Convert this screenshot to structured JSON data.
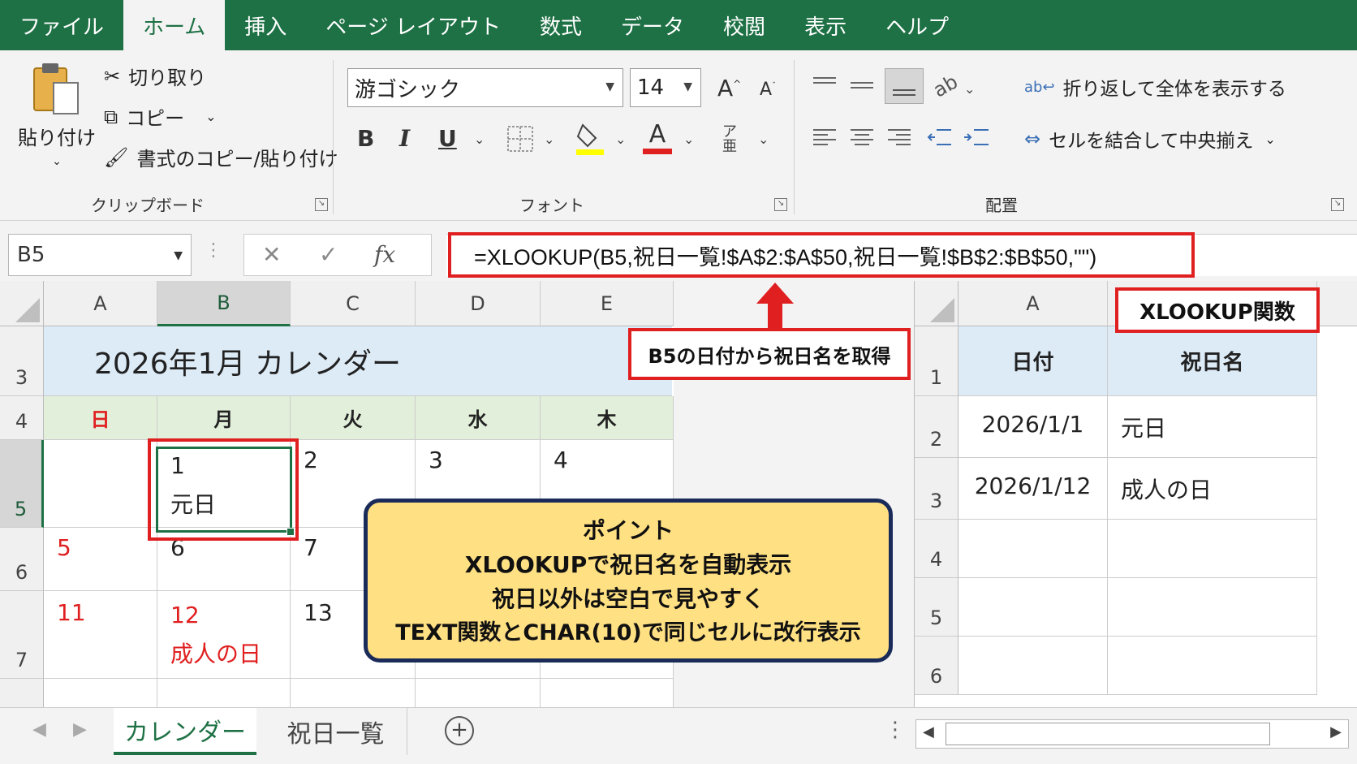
{
  "tabs": [
    "ファイル",
    "ホーム",
    "挿入",
    "ページ レイアウト",
    "数式",
    "データ",
    "校閲",
    "表示",
    "ヘルプ"
  ],
  "active_tab": "ホーム",
  "clipboard": {
    "paste": "貼り付け",
    "cut": "切り取り",
    "copy": "コピー",
    "format_painter": "書式のコピー/貼り付け",
    "label": "クリップボード"
  },
  "font": {
    "name": "游ゴシック",
    "size": "14",
    "bold": "B",
    "italic": "I",
    "underline": "U",
    "label": "フォント"
  },
  "alignment": {
    "wrap": "折り返して全体を表示する",
    "merge": "セルを結合して中央揃え",
    "label": "配置"
  },
  "formula_bar": {
    "name_box": "B5",
    "fx": "fx",
    "formula": "=XLOOKUP(B5,祝日一覧!$A$2:$A$50,祝日一覧!$B$2:$B$50,\"\")"
  },
  "left_grid": {
    "columns": [
      "A",
      "B",
      "C",
      "D",
      "E"
    ],
    "rows": [
      "3",
      "4",
      "5",
      "6",
      "7"
    ],
    "title": "2026年1月 カレンダー",
    "days": [
      "日",
      "月",
      "火",
      "水",
      "木"
    ],
    "week1": [
      "",
      "1",
      "2",
      "3",
      "4"
    ],
    "b5_holiday": "元日",
    "week2": [
      "5",
      "6",
      "7"
    ],
    "week3": [
      "11",
      "12",
      "13"
    ],
    "b7_holiday": "成人の日"
  },
  "right_grid": {
    "column_a": "A",
    "rows": [
      "1",
      "2",
      "3",
      "4",
      "5",
      "6"
    ],
    "header_date": "日付",
    "header_name": "祝日名",
    "data": [
      {
        "date": "2026/1/1",
        "name": "元日"
      },
      {
        "date": "2026/1/12",
        "name": "成人の日"
      }
    ]
  },
  "annotations": {
    "callout_formula": "B5の日付から祝日名を取得",
    "callout_func": "XLOOKUP関数",
    "point_title": "ポイント",
    "point_lines": [
      "XLOOKUPで祝日名を自動表示",
      "祝日以外は空白で見やすく",
      "TEXT関数とCHAR(10)で同じセルに改行表示"
    ]
  },
  "sheets": [
    "カレンダー",
    "祝日一覧"
  ],
  "colors": {
    "excel_green": "#1e7145",
    "highlight_red": "#e02020",
    "point_bg": "#ffe083"
  }
}
